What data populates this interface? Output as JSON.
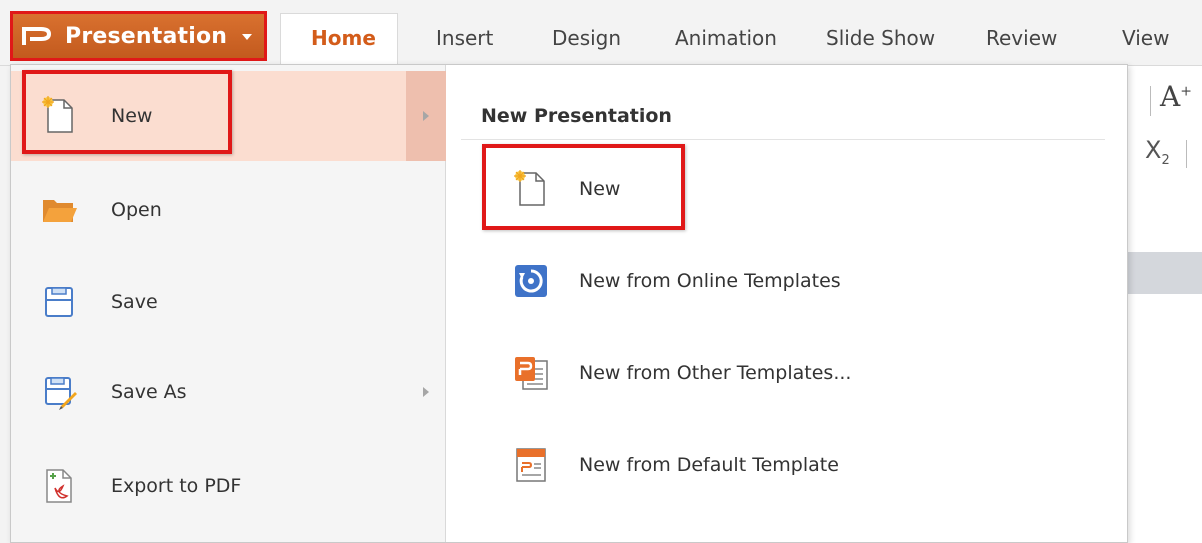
{
  "app_menu": {
    "label": "Presentation"
  },
  "ribbon": {
    "tabs": [
      {
        "label": "Home",
        "active": true
      },
      {
        "label": "Insert"
      },
      {
        "label": "Design"
      },
      {
        "label": "Animation"
      },
      {
        "label": "Slide Show"
      },
      {
        "label": "Review"
      },
      {
        "label": "View"
      }
    ],
    "font_grow_label": "A",
    "subscript_label": "X"
  },
  "file_menu": {
    "items": [
      {
        "label": "New",
        "icon": "new-document-icon",
        "has_submenu": true,
        "selected": true
      },
      {
        "label": "Open",
        "icon": "folder-open-icon"
      },
      {
        "label": "Save",
        "icon": "save-icon"
      },
      {
        "label": "Save As",
        "icon": "save-as-icon",
        "has_submenu": true
      },
      {
        "label": "Export to PDF",
        "icon": "pdf-export-icon"
      }
    ]
  },
  "submenu": {
    "title": "New Presentation",
    "items": [
      {
        "label": "New",
        "icon": "new-document-icon"
      },
      {
        "label": "New from Online Templates",
        "icon": "online-templates-icon"
      },
      {
        "label": "New from Other Templates...",
        "icon": "other-templates-icon"
      },
      {
        "label": "New from Default Template",
        "icon": "default-template-icon"
      }
    ]
  },
  "colors": {
    "accent": "#d35c1a",
    "highlight": "#e01818",
    "selected_bg": "#fbddd0"
  }
}
